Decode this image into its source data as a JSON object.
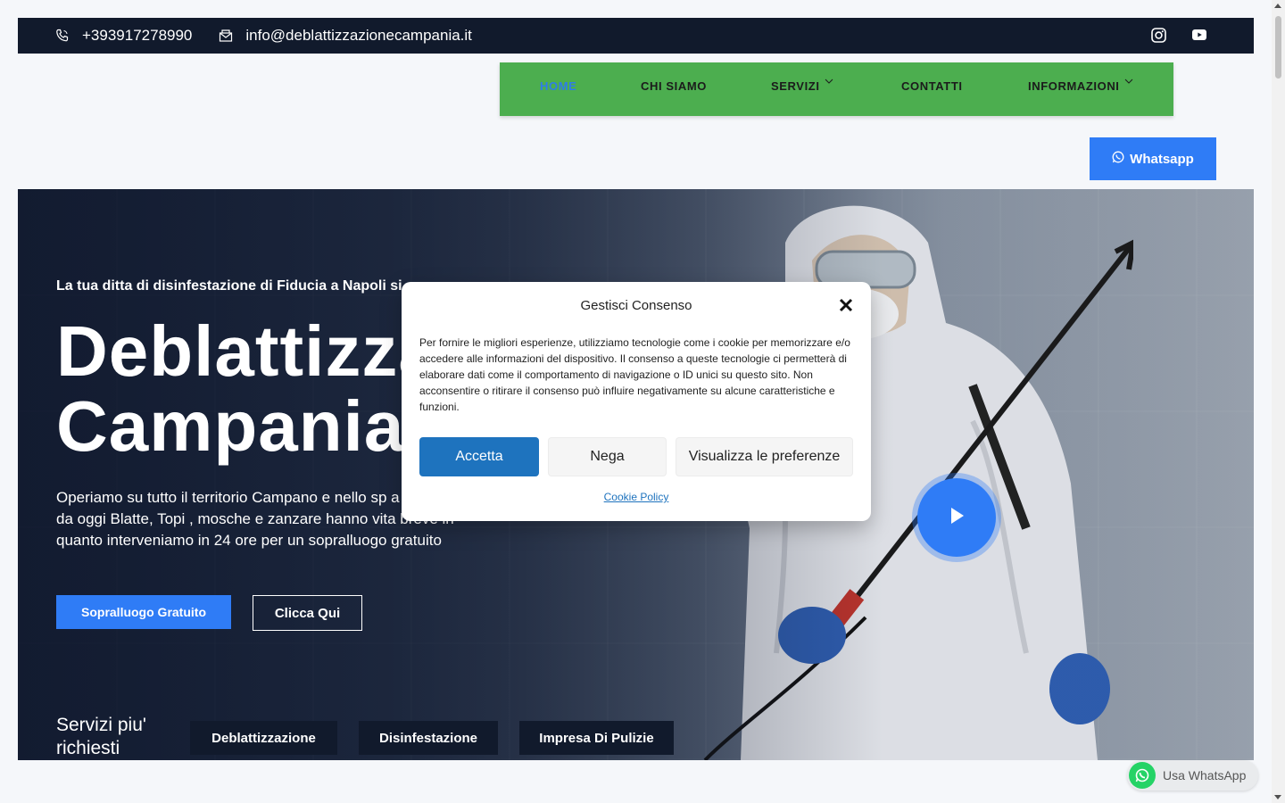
{
  "topbar": {
    "phone": "+393917278990",
    "email": "info@deblattizzazionecampania.it",
    "icons": [
      "phone-icon",
      "email-icon",
      "instagram-icon",
      "youtube-icon"
    ]
  },
  "nav": {
    "items": [
      {
        "label": "HOME",
        "active": true
      },
      {
        "label": "CHI SIAMO"
      },
      {
        "label": "SERVIZI",
        "dropdown": true
      },
      {
        "label": "CONTATTI"
      },
      {
        "label": "INFORMAZIONI",
        "dropdown": true
      }
    ]
  },
  "whatsapp_button": {
    "label": "Whatsapp"
  },
  "hero": {
    "tagline": "La tua ditta di disinfestazione di Fiducia a Napoli si o",
    "heading_line1": "Deblattizza",
    "heading_line2": "Campania",
    "description": "Operiamo su tutto il territorio Campano e nello sp a Napoli da oggi Blatte, Topi , mosche e zanzare hanno vita breve in quanto interveniamo in 24 ore per un sopralluogo gratuito",
    "cta_primary": "Sopralluogo Gratuito",
    "cta_secondary": "Clicca Qui"
  },
  "services": {
    "title": "Servizi piu' richiesti",
    "items": [
      "Deblattizzazione",
      "Disinfestazione",
      "Impresa Di Pulizie"
    ]
  },
  "consent_modal": {
    "title": "Gestisci Consenso",
    "body": "Per fornire le migliori esperienze, utilizziamo tecnologie come i cookie per memorizzare e/o accedere alle informazioni del dispositivo. Il consenso a queste tecnologie ci permetterà di elaborare dati come il comportamento di navigazione o ID unici su questo sito. Non acconsentire o ritirare il consenso può influire negativamente su alcune caratteristiche e funzioni.",
    "accept": "Accetta",
    "deny": "Nega",
    "preferences": "Visualizza le preferenze",
    "policy_link": "Cookie Policy"
  },
  "floating_whatsapp": {
    "label": "Usa WhatsApp"
  },
  "colors": {
    "topbar_bg": "#111a2c",
    "nav_bg": "#4cae4f",
    "accent_blue": "#2f7cf6",
    "accept_blue": "#1e73be",
    "whatsapp_green": "#25d366"
  }
}
